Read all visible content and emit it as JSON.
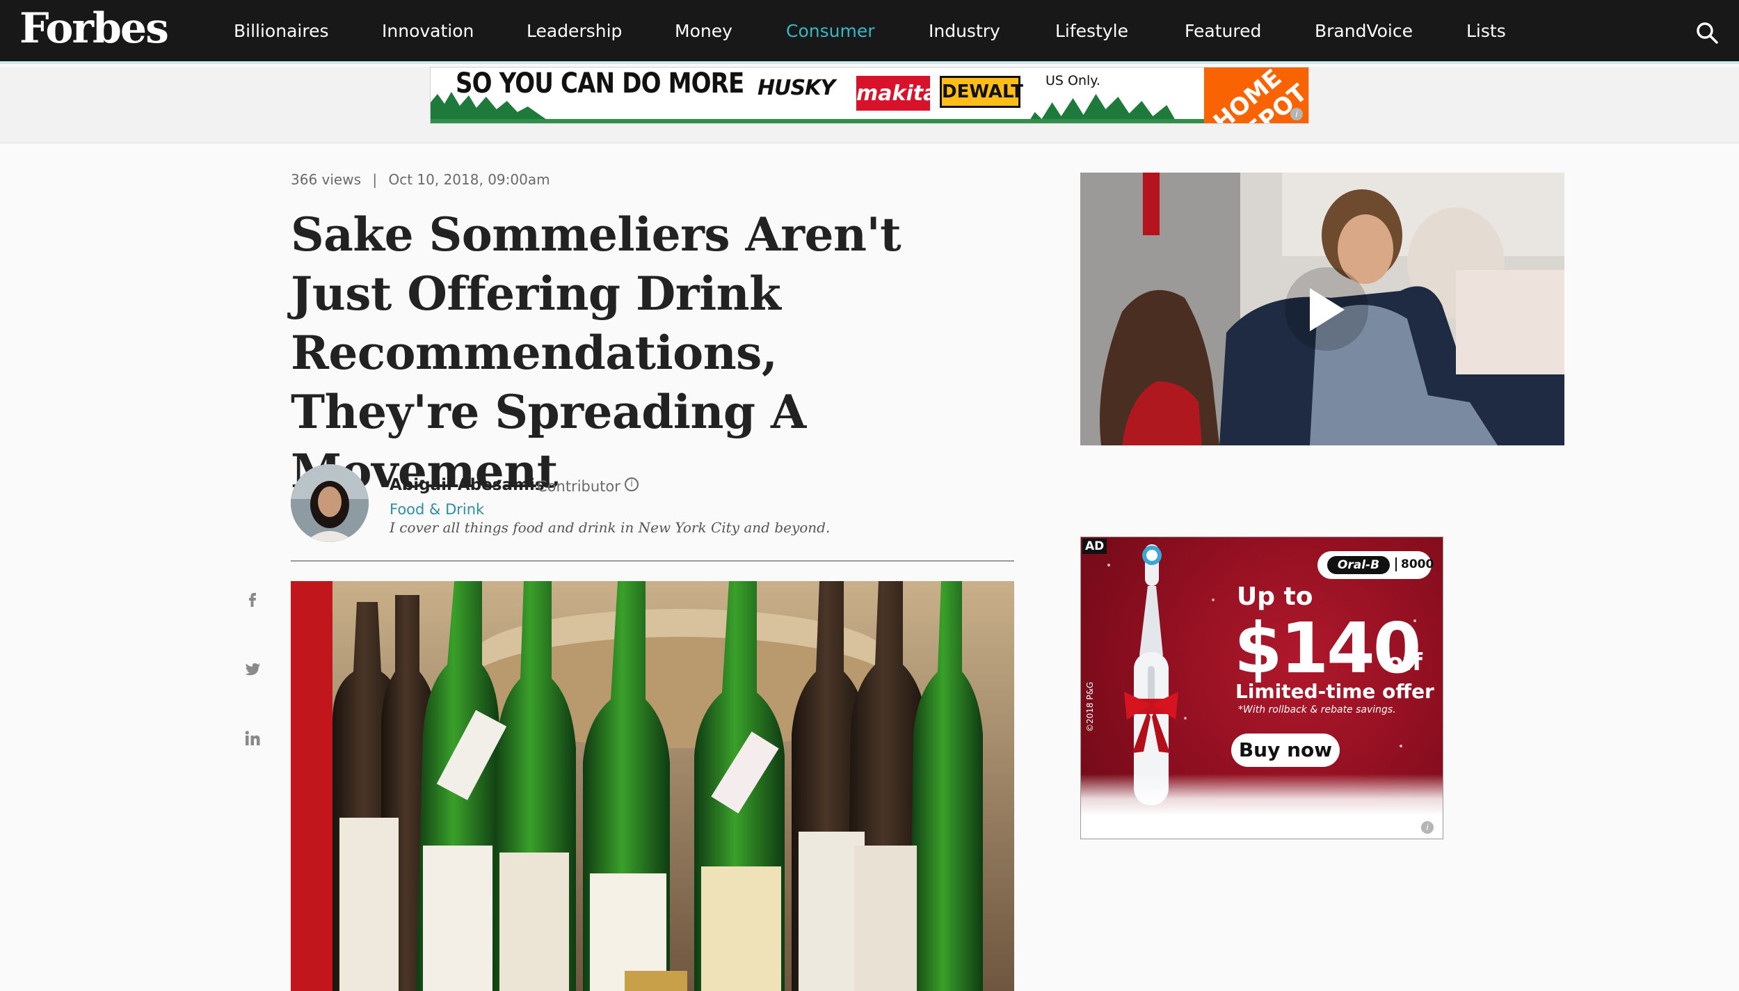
{
  "nav": {
    "logo": "Forbes",
    "items": [
      {
        "label": "Billionaires"
      },
      {
        "label": "Innovation"
      },
      {
        "label": "Leadership"
      },
      {
        "label": "Money"
      },
      {
        "label": "Consumer",
        "active": true
      },
      {
        "label": "Industry"
      },
      {
        "label": "Lifestyle"
      },
      {
        "label": "Featured"
      },
      {
        "label": "BrandVoice"
      },
      {
        "label": "Lists"
      }
    ],
    "search_icon": "search-icon",
    "accent_color": "#38b8c6"
  },
  "top_ad": {
    "slogan": "SO YOU CAN DO MORE",
    "brands": [
      "HUSKY",
      "makita",
      "DEWALT"
    ],
    "note": "US Only.",
    "retailer": "HOME DEPOT",
    "info_icon": "info-icon"
  },
  "article": {
    "meta": {
      "views": "366 views",
      "separator": "|",
      "date": "Oct 10, 2018, 09:00am"
    },
    "title": "Sake Sommeliers Aren't Just Offering Drink Recommendations, They're Spreading A Movement",
    "author": {
      "name": "Abigail Abesamis",
      "role": "Contributor",
      "channel": "Food & Drink",
      "bio": "I cover all things food and drink in New York City and beyond."
    },
    "share": [
      "facebook-icon",
      "twitter-icon",
      "linkedin-icon"
    ]
  },
  "side_ad": {
    "tag": "AD",
    "brand": "Oral-B",
    "model": "8000",
    "up_to": "Up to",
    "price": "$140",
    "off": "off",
    "offer": "Limited-time offer",
    "fine_print": "*With rollback & rebate savings.",
    "cta": "Buy now",
    "copyright": "©2018 P&G",
    "brand_color": "#a3142a"
  }
}
